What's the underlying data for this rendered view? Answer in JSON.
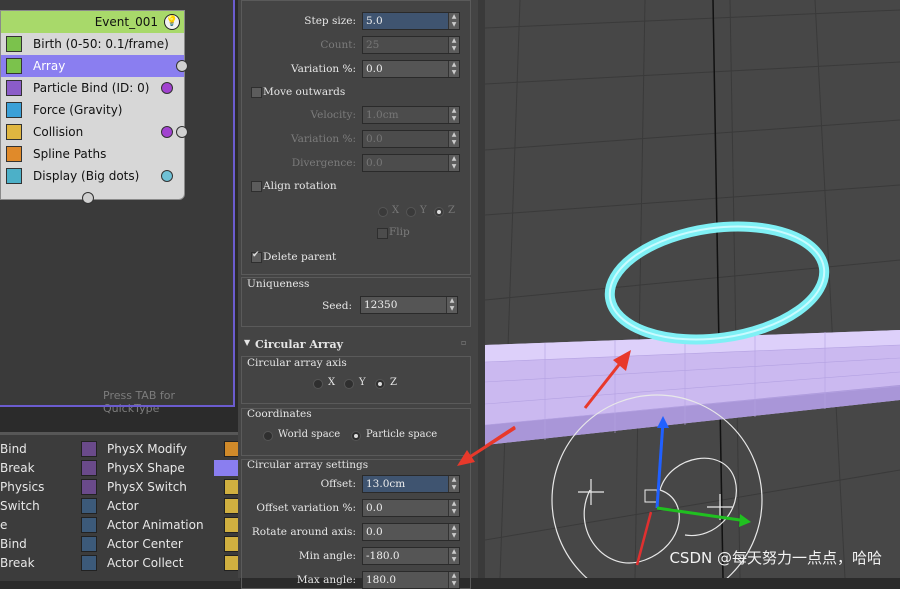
{
  "graph": {
    "event_title": "Event_001",
    "operators": [
      {
        "label": "Birth (0-50: 0.1/frame)",
        "icon": "birth-icon",
        "color": "#7bc24c"
      },
      {
        "label": "Array",
        "icon": "array-icon",
        "color": "#7bc24c"
      },
      {
        "label": "Particle Bind (ID: 0)",
        "icon": "particle-bind-icon",
        "color": "#8b5cc8"
      },
      {
        "label": "Force (Gravity)",
        "icon": "force-icon",
        "color": "#3aa0d8"
      },
      {
        "label": "Collision",
        "icon": "collision-icon",
        "color": "#e0b640"
      },
      {
        "label": "Spline Paths",
        "icon": "spline-paths-icon",
        "color": "#e08a2a"
      },
      {
        "label": "Display (Big dots)",
        "icon": "display-icon",
        "color": "#4cb0c8"
      }
    ],
    "hint": "Press TAB for QuickType"
  },
  "depot": {
    "col1": [
      "Bind",
      "Break",
      "Physics",
      "Switch",
      "e",
      "Bind",
      "Break"
    ],
    "col2": [
      "PhysX Modify",
      "PhysX Shape",
      "PhysX Switch",
      "Actor",
      "Actor Animation",
      "Actor Center",
      "Actor Collect"
    ]
  },
  "panel": {
    "step_size": {
      "label": "Step size:",
      "value": "5.0"
    },
    "count": {
      "label": "Count:",
      "value": "25"
    },
    "variation1": {
      "label": "Variation %:",
      "value": "0.0"
    },
    "move_outwards": "Move outwards",
    "velocity": {
      "label": "Velocity:",
      "value": "1.0cm"
    },
    "variation2": {
      "label": "Variation %:",
      "value": "0.0"
    },
    "divergence": {
      "label": "Divergence:",
      "value": "0.0"
    },
    "align_rotation": "Align rotation",
    "axis_xyz": [
      "X",
      "Y",
      "Z"
    ],
    "flip": "Flip",
    "delete_parent": "Delete parent",
    "uniqueness": {
      "title": "Uniqueness",
      "seed_label": "Seed:",
      "seed_value": "12350"
    },
    "circular_array": {
      "title": "Circular Array",
      "axis_title": "Circular array axis",
      "axis_options": [
        "X",
        "Y",
        "Z"
      ],
      "coords_title": "Coordinates",
      "coords_options": [
        "World space",
        "Particle space"
      ],
      "settings_title": "Circular array settings",
      "offset": {
        "label": "Offset:",
        "value": "13.0cm"
      },
      "offset_var": {
        "label": "Offset variation %:",
        "value": "0.0"
      },
      "rotate": {
        "label": "Rotate around axis:",
        "value": "0.0"
      },
      "min_angle": {
        "label": "Min angle:",
        "value": "-180.0"
      },
      "max_angle": {
        "label": "Max angle:",
        "value": "180.0"
      }
    }
  },
  "viewport": {
    "watermark": "CSDN @每天努力一点点，哈哈",
    "annotation_color": "#e8392b",
    "ring_color": "#7ff0f5",
    "tube_color": "#c9b8f0"
  }
}
